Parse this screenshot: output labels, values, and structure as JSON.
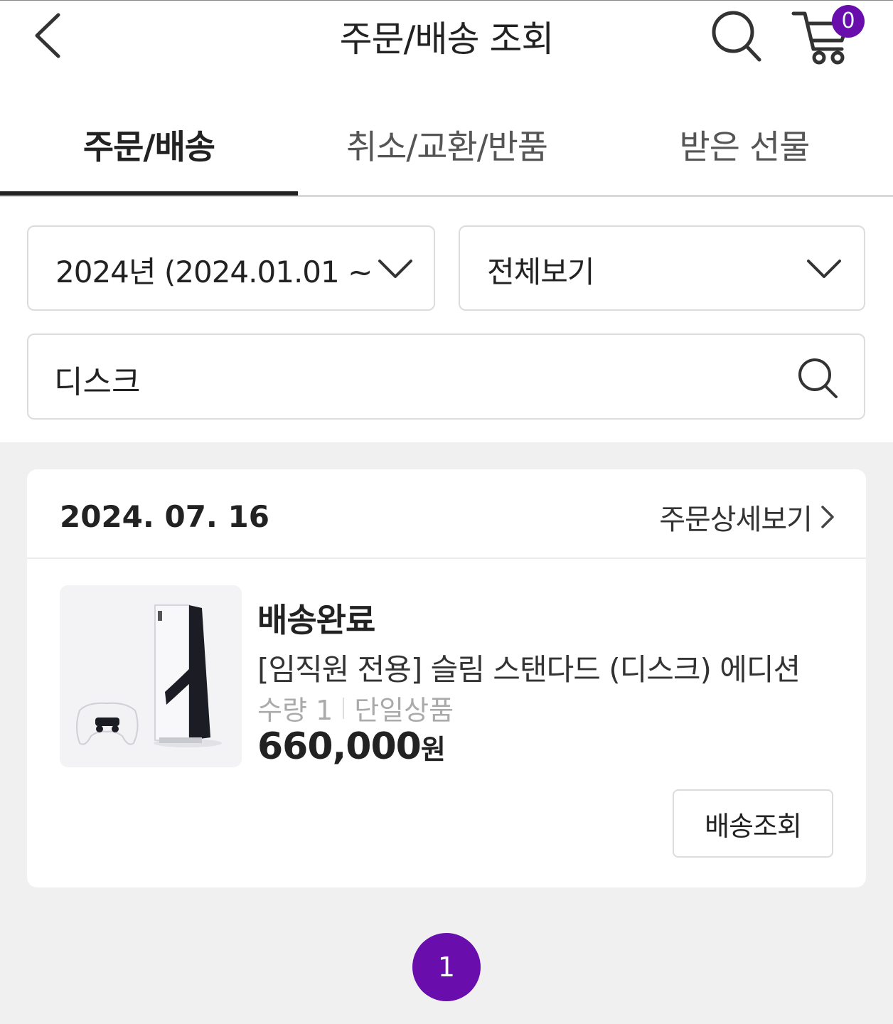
{
  "header": {
    "title": "주문/배송 조회",
    "back_icon": "chevron-left-icon",
    "search_icon": "search-icon",
    "cart_icon": "cart-icon",
    "cart_count": "0"
  },
  "tabs": [
    {
      "label": "주문/배송",
      "active": true
    },
    {
      "label": "취소/교환/반품",
      "active": false
    },
    {
      "label": "받은 선물",
      "active": false
    }
  ],
  "filters": {
    "period": "2024년 (2024.01.01 ~",
    "type": "전체보기"
  },
  "search": {
    "value": "디스크"
  },
  "order": {
    "date": "2024. 07. 16",
    "detail_label": "주문상세보기",
    "status": "배송완료",
    "product_name": "[임직원 전용] 슬림 스탠다드 (디스크) 에디션",
    "quantity": "수량 1",
    "option": "단일상품",
    "price": "660,000",
    "currency": "원",
    "track_button": "배송조회"
  },
  "pagination": {
    "current": "1"
  },
  "colors": {
    "accent": "#6a0dad",
    "text": "#222222",
    "muted": "#aaaaaa",
    "background": "#f0f0f0"
  }
}
